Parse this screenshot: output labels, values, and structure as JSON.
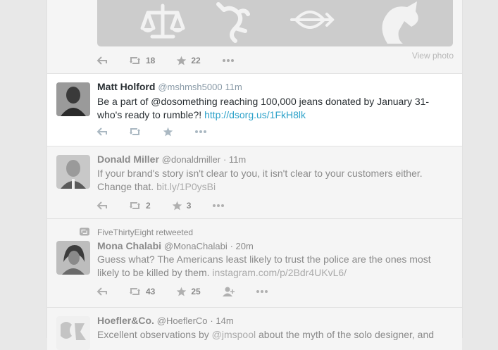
{
  "photo_tweet": {
    "retweet_count": "18",
    "favorite_count": "22",
    "view_photo_label": "View photo"
  },
  "tweets": [
    {
      "name": "Matt Holford",
      "handle": "@mshmsh5000",
      "time": "11m",
      "text": "Be a part of @dosomething reaching 100,000 jeans donated by January 31- who's ready to rumble?! ",
      "link": "http://dsorg.us/1FkH8lk"
    },
    {
      "name": "Donald Miller",
      "handle": "@donaldmiller",
      "time": "· 11m",
      "text": "If your brand's story isn't clear to you, it isn't clear to your customers either. Change that. ",
      "link": "bit.ly/1P0ysBi",
      "retweet_count": "2",
      "favorite_count": "3"
    },
    {
      "retweeted_by": "FiveThirtyEight retweeted",
      "name": "Mona Chalabi",
      "handle": "@MonaChalabi",
      "time": "· 20m",
      "text": "Guess what? The Americans least likely to trust the police are the ones most likely to be killed by them. ",
      "link": "instagram.com/p/2Bdr4UKvL6/",
      "retweet_count": "43",
      "favorite_count": "25"
    },
    {
      "name": "Hoefler&Co.",
      "handle": "@HoeflerCo",
      "time": "· 14m",
      "text_before": "Excellent observations by ",
      "mention": "@jmspool",
      "text_after": " about the myth of the solo designer, and"
    }
  ],
  "colors": {
    "link_active": "#2ba1c9",
    "photo_bg": "#cccccc",
    "active_bg": "#ffffff",
    "dim_bg": "#f5f5f5"
  }
}
